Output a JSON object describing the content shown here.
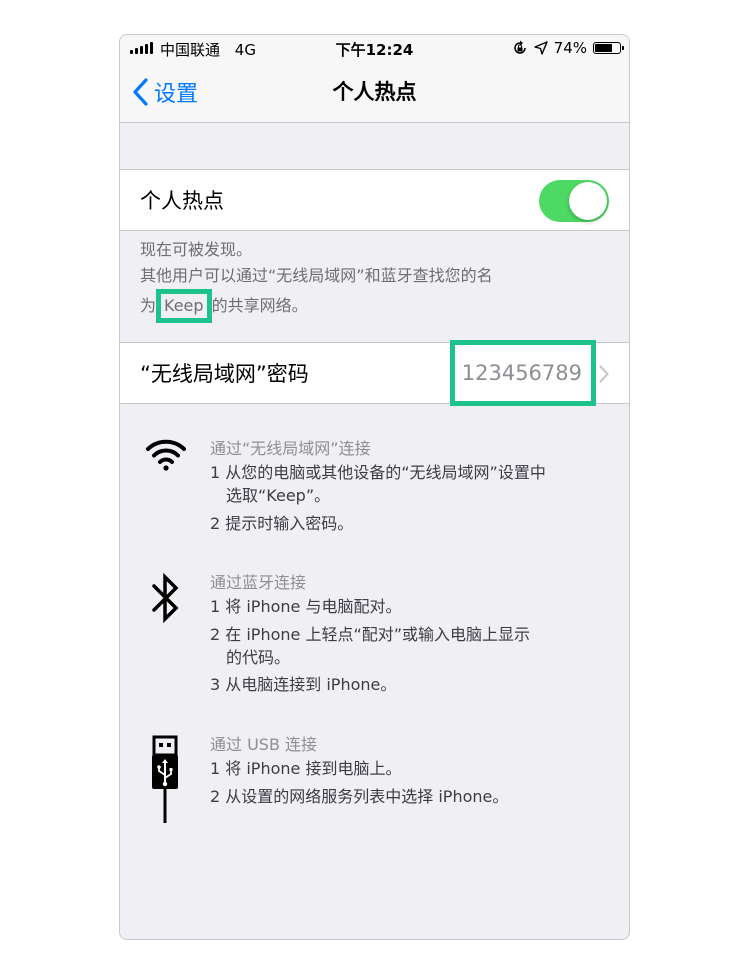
{
  "status_bar": {
    "carrier": "中国联通",
    "network": "4G",
    "time": "下午12:24",
    "battery": "74%",
    "battery_level": 0.74,
    "icons": [
      "signal-bars-icon",
      "orientation-lock-icon",
      "location-arrow-icon",
      "battery-icon"
    ]
  },
  "nav": {
    "back_label": "设置",
    "title": "个人热点"
  },
  "hotspot": {
    "label": "个人热点",
    "enabled": true,
    "accent_color": "#4cd964"
  },
  "footer": {
    "line1": "现在可被发现。",
    "line2": "其他用户可以通过“无线局域网”和蓝牙查找您的名",
    "line3_prefix": "为",
    "device_name": "Keep",
    "line3_suffix": "的共享网络。"
  },
  "password": {
    "label": "“无线局域网”密码",
    "value": "123456789"
  },
  "wifi_section": {
    "icon": "wifi-icon",
    "title": "通过“无线局域网”连接",
    "step1_a": "1 从您的电脑或其他设备的“无线局域网”设置中",
    "step1_b": "选取“Keep”。",
    "step2": "2 提示时输入密码。"
  },
  "bluetooth_section": {
    "icon": "bluetooth-icon",
    "title": "通过蓝牙连接",
    "step1": "1 将 iPhone 与电脑配对。",
    "step2_a": "2 在 iPhone 上轻点“配对”或输入电脑上显示",
    "step2_b": "的代码。",
    "step3": "3 从电脑连接到 iPhone。"
  },
  "usb_section": {
    "icon": "usb-icon",
    "title": "通过 USB 连接",
    "step1": "1 将 iPhone 接到电脑上。",
    "step2": "2 从设置的网络服务列表中选择 iPhone。"
  },
  "highlight_color": "#1ec38b"
}
